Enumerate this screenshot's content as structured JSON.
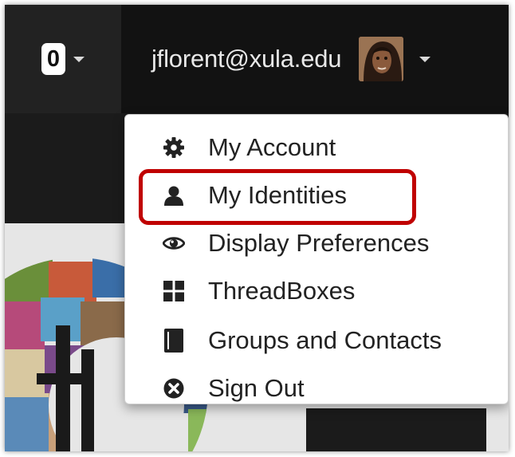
{
  "header": {
    "notification_count": "0",
    "user_email": "jflorent@xula.edu",
    "icons": {
      "count_caret": "caret-down-icon",
      "user_caret": "caret-down-icon",
      "avatar": "user-avatar"
    }
  },
  "user_menu": {
    "items": [
      {
        "label": "My Account",
        "icon": "gear-icon"
      },
      {
        "label": "My Identities",
        "icon": "person-icon"
      },
      {
        "label": "Display Preferences",
        "icon": "eye-icon"
      },
      {
        "label": "ThreadBoxes",
        "icon": "grid-icon"
      },
      {
        "label": "Groups and Contacts",
        "icon": "book-icon"
      },
      {
        "label": "Sign Out",
        "icon": "sign-out-icon"
      }
    ],
    "highlighted_item": "My Identities"
  },
  "colors": {
    "topbar": "#121212",
    "menu_background": "#ffffff",
    "highlight_outline": "#c00000",
    "text": "#222222"
  }
}
